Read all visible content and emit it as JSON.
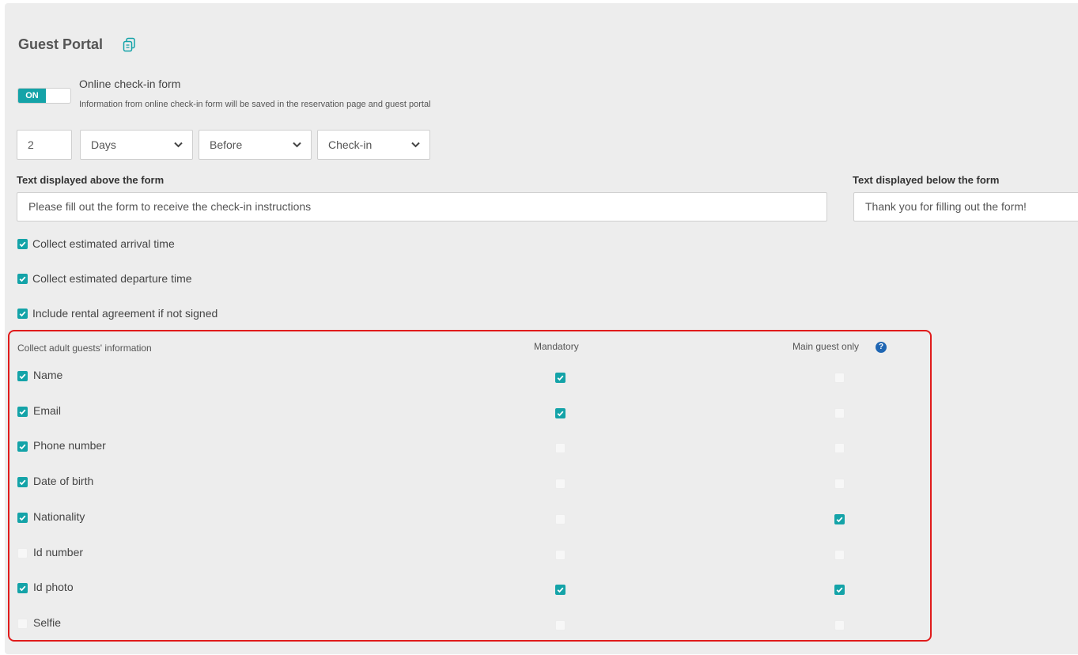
{
  "section": {
    "title": "Guest Portal",
    "copy_icon": "copy-icon"
  },
  "online_checkin": {
    "toggle_state": "ON",
    "label": "Online check-in form",
    "help": "Information from online check-in form will be saved in the reservation page and guest portal"
  },
  "timing": {
    "amount": "2",
    "unit": "Days",
    "relation": "Before",
    "event": "Check-in"
  },
  "text_above": {
    "label": "Text displayed above the form",
    "value": "Please fill out the form to receive the check-in instructions"
  },
  "text_below": {
    "label": "Text displayed below the form",
    "value": "Thank you for filling out the form!"
  },
  "options": [
    {
      "label": "Collect estimated arrival time",
      "checked": true
    },
    {
      "label": "Collect estimated departure time",
      "checked": true
    },
    {
      "label": "Include rental agreement if not signed",
      "checked": true
    }
  ],
  "guest_info": {
    "header": "Collect adult guests' information",
    "mandatory_header": "Mandatory",
    "main_guest_header": "Main guest only",
    "help_icon": "question-circle-icon",
    "rows": [
      {
        "label": "Name",
        "collect": true,
        "mandatory": true,
        "main_only": false
      },
      {
        "label": "Email",
        "collect": true,
        "mandatory": true,
        "main_only": false
      },
      {
        "label": "Phone number",
        "collect": true,
        "mandatory": false,
        "main_only": false
      },
      {
        "label": "Date of birth",
        "collect": true,
        "mandatory": false,
        "main_only": false
      },
      {
        "label": "Nationality",
        "collect": true,
        "mandatory": false,
        "main_only": true
      },
      {
        "label": "Id number",
        "collect": false,
        "mandatory": false,
        "main_only": false
      },
      {
        "label": "Id photo",
        "collect": true,
        "mandatory": true,
        "main_only": true
      },
      {
        "label": "Selfie",
        "collect": false,
        "mandatory": false,
        "main_only": false
      }
    ]
  },
  "colors": {
    "accent": "#14a3a8",
    "highlight_border": "#e01b1b",
    "help_icon": "#1f66b3"
  }
}
